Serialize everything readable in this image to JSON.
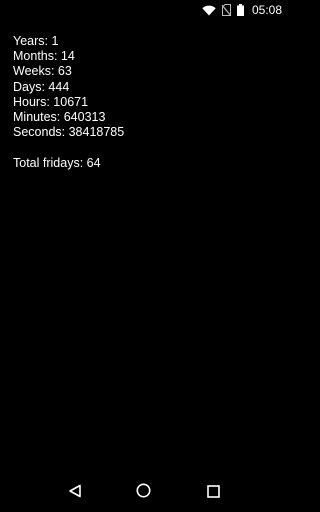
{
  "status_bar": {
    "time": "05:08",
    "icons": [
      "wifi-icon",
      "no-sim-icon",
      "battery-icon"
    ]
  },
  "stats": {
    "years": "Years: 1",
    "months": "Months: 14",
    "weeks": "Weeks: 63",
    "days": "Days: 444",
    "hours": "Hours: 10671",
    "minutes": "Minutes: 640313",
    "seconds": "Seconds: 38418785",
    "total_fridays": "Total fridays: 64"
  },
  "nav_bar": {
    "icons": [
      "back-icon",
      "home-icon",
      "recents-icon"
    ]
  },
  "colors": {
    "background": "#000000",
    "text": "#ffffff"
  }
}
